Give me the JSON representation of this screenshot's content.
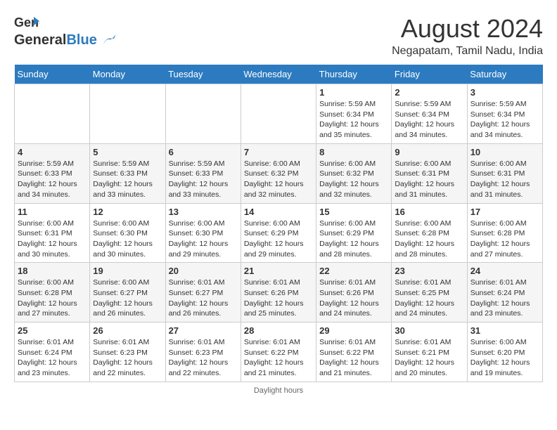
{
  "header": {
    "logo_general": "General",
    "logo_blue": "Blue",
    "month_year": "August 2024",
    "location": "Negapatam, Tamil Nadu, India"
  },
  "days_of_week": [
    "Sunday",
    "Monday",
    "Tuesday",
    "Wednesday",
    "Thursday",
    "Friday",
    "Saturday"
  ],
  "weeks": [
    [
      {
        "day": "",
        "info": ""
      },
      {
        "day": "",
        "info": ""
      },
      {
        "day": "",
        "info": ""
      },
      {
        "day": "",
        "info": ""
      },
      {
        "day": "1",
        "info": "Sunrise: 5:59 AM\nSunset: 6:34 PM\nDaylight: 12 hours\nand 35 minutes."
      },
      {
        "day": "2",
        "info": "Sunrise: 5:59 AM\nSunset: 6:34 PM\nDaylight: 12 hours\nand 34 minutes."
      },
      {
        "day": "3",
        "info": "Sunrise: 5:59 AM\nSunset: 6:34 PM\nDaylight: 12 hours\nand 34 minutes."
      }
    ],
    [
      {
        "day": "4",
        "info": "Sunrise: 5:59 AM\nSunset: 6:33 PM\nDaylight: 12 hours\nand 34 minutes."
      },
      {
        "day": "5",
        "info": "Sunrise: 5:59 AM\nSunset: 6:33 PM\nDaylight: 12 hours\nand 33 minutes."
      },
      {
        "day": "6",
        "info": "Sunrise: 5:59 AM\nSunset: 6:33 PM\nDaylight: 12 hours\nand 33 minutes."
      },
      {
        "day": "7",
        "info": "Sunrise: 6:00 AM\nSunset: 6:32 PM\nDaylight: 12 hours\nand 32 minutes."
      },
      {
        "day": "8",
        "info": "Sunrise: 6:00 AM\nSunset: 6:32 PM\nDaylight: 12 hours\nand 32 minutes."
      },
      {
        "day": "9",
        "info": "Sunrise: 6:00 AM\nSunset: 6:31 PM\nDaylight: 12 hours\nand 31 minutes."
      },
      {
        "day": "10",
        "info": "Sunrise: 6:00 AM\nSunset: 6:31 PM\nDaylight: 12 hours\nand 31 minutes."
      }
    ],
    [
      {
        "day": "11",
        "info": "Sunrise: 6:00 AM\nSunset: 6:31 PM\nDaylight: 12 hours\nand 30 minutes."
      },
      {
        "day": "12",
        "info": "Sunrise: 6:00 AM\nSunset: 6:30 PM\nDaylight: 12 hours\nand 30 minutes."
      },
      {
        "day": "13",
        "info": "Sunrise: 6:00 AM\nSunset: 6:30 PM\nDaylight: 12 hours\nand 29 minutes."
      },
      {
        "day": "14",
        "info": "Sunrise: 6:00 AM\nSunset: 6:29 PM\nDaylight: 12 hours\nand 29 minutes."
      },
      {
        "day": "15",
        "info": "Sunrise: 6:00 AM\nSunset: 6:29 PM\nDaylight: 12 hours\nand 28 minutes."
      },
      {
        "day": "16",
        "info": "Sunrise: 6:00 AM\nSunset: 6:28 PM\nDaylight: 12 hours\nand 28 minutes."
      },
      {
        "day": "17",
        "info": "Sunrise: 6:00 AM\nSunset: 6:28 PM\nDaylight: 12 hours\nand 27 minutes."
      }
    ],
    [
      {
        "day": "18",
        "info": "Sunrise: 6:00 AM\nSunset: 6:28 PM\nDaylight: 12 hours\nand 27 minutes."
      },
      {
        "day": "19",
        "info": "Sunrise: 6:00 AM\nSunset: 6:27 PM\nDaylight: 12 hours\nand 26 minutes."
      },
      {
        "day": "20",
        "info": "Sunrise: 6:01 AM\nSunset: 6:27 PM\nDaylight: 12 hours\nand 26 minutes."
      },
      {
        "day": "21",
        "info": "Sunrise: 6:01 AM\nSunset: 6:26 PM\nDaylight: 12 hours\nand 25 minutes."
      },
      {
        "day": "22",
        "info": "Sunrise: 6:01 AM\nSunset: 6:26 PM\nDaylight: 12 hours\nand 24 minutes."
      },
      {
        "day": "23",
        "info": "Sunrise: 6:01 AM\nSunset: 6:25 PM\nDaylight: 12 hours\nand 24 minutes."
      },
      {
        "day": "24",
        "info": "Sunrise: 6:01 AM\nSunset: 6:24 PM\nDaylight: 12 hours\nand 23 minutes."
      }
    ],
    [
      {
        "day": "25",
        "info": "Sunrise: 6:01 AM\nSunset: 6:24 PM\nDaylight: 12 hours\nand 23 minutes."
      },
      {
        "day": "26",
        "info": "Sunrise: 6:01 AM\nSunset: 6:23 PM\nDaylight: 12 hours\nand 22 minutes."
      },
      {
        "day": "27",
        "info": "Sunrise: 6:01 AM\nSunset: 6:23 PM\nDaylight: 12 hours\nand 22 minutes."
      },
      {
        "day": "28",
        "info": "Sunrise: 6:01 AM\nSunset: 6:22 PM\nDaylight: 12 hours\nand 21 minutes."
      },
      {
        "day": "29",
        "info": "Sunrise: 6:01 AM\nSunset: 6:22 PM\nDaylight: 12 hours\nand 21 minutes."
      },
      {
        "day": "30",
        "info": "Sunrise: 6:01 AM\nSunset: 6:21 PM\nDaylight: 12 hours\nand 20 minutes."
      },
      {
        "day": "31",
        "info": "Sunrise: 6:00 AM\nSunset: 6:20 PM\nDaylight: 12 hours\nand 19 minutes."
      }
    ]
  ],
  "footer": {
    "daylight_hours": "Daylight hours"
  }
}
